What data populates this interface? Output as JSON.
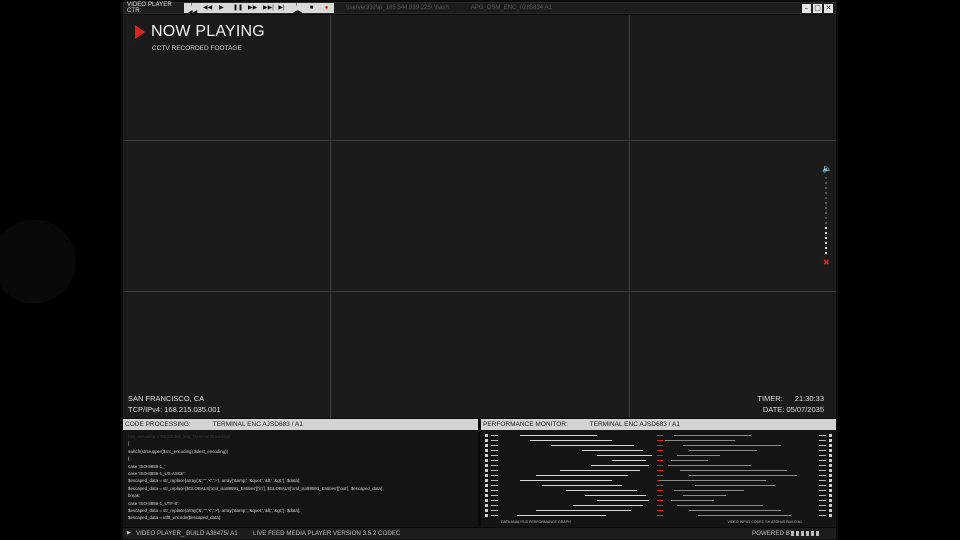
{
  "topbar": {
    "title": "VIDEO PLAYER CTR:",
    "controls": [
      {
        "name": "previous-chapter-icon",
        "glyph": "|◀◀"
      },
      {
        "name": "rewind-icon",
        "glyph": "◀◀"
      },
      {
        "name": "play-icon",
        "glyph": "▶"
      },
      {
        "name": "pause-icon",
        "glyph": "❚❚"
      },
      {
        "name": "fast-forward-icon",
        "glyph": "▶▶"
      },
      {
        "name": "next-chapter-icon",
        "glyph": "▶▶|"
      },
      {
        "name": "step-forward-icon",
        "glyph": "▶|"
      },
      {
        "name": "step-back-icon",
        "glyph": "|◀▶"
      },
      {
        "name": "stop-icon",
        "glyph": "■"
      },
      {
        "name": "record-icon",
        "glyph": "●"
      }
    ],
    "path": "\\\\server332\\ip_185.544.889.225\\ \\hash",
    "codec": "APG_OSM_ENC_0285834 A1",
    "window_buttons": [
      {
        "name": "minimize-icon",
        "glyph": "–"
      },
      {
        "name": "maximize-icon",
        "glyph": "▢"
      },
      {
        "name": "close-icon",
        "glyph": "✕"
      }
    ]
  },
  "video": {
    "now_playing": "NOW PLAYING",
    "subtitle": "CCTV RECORDED FOOTAGE",
    "location": "SAN FRANCISCO, CA",
    "tcp": "TCP/IPv4: 168.215.035.001",
    "timer_label": "TIMER:",
    "timer_value": "21:30:33",
    "date": "DATE: 05/07/2035",
    "volume_level": 0.4,
    "volume_steps": 16
  },
  "code_panel": {
    "title": "CODE PROCESSING:",
    "terminal": "TERMINAL ENC AJSD683 / A1",
    "lines": [
      {
        "text": "fast_encoding = RE(Global_seq_Terminal Encoding)",
        "faded": true
      },
      {
        "text": "{",
        "faded": false
      },
      {
        "text": "switch(strtoupper($src_encoding)   $dest_encoding))",
        "faded": false
      },
      {
        "text": "{",
        "faded": false
      },
      {
        "text": "case 'ISO-8859-1_':",
        "faded": false
      },
      {
        "text": "case 'ISO-8859-1_US-ASCII':",
        "faded": false
      },
      {
        "text": "$escaped_data = str_replace(array('&','\"','<','>'), array('&amp;','&quot;','&lt;','&gt;'), $data);",
        "faded": false
      },
      {
        "text": "$escaped_data = str_replace($GLOBALS['xml_iso88591_Entities']['in'], $GLOBALS['xml_iso88591_Entities']['out'], $escaped_data);",
        "faded": false
      },
      {
        "text": "break;",
        "faded": false
      },
      {
        "text": "case 'ISO-8859-1_UTF-8':",
        "faded": false
      },
      {
        "text": "$escaped_data = str_replace(array('&','\"','<','>'), array('&amp;','&quot;','&lt;','&gt;'), $data);",
        "faded": false
      },
      {
        "text": "$escaped_data = utf8_encode($escaped_data);",
        "faded": false
      }
    ]
  },
  "perf_panel": {
    "title": "PERFORMANCE MONITOR:",
    "terminal": "TERMINAL ENC AJSD683 / A1",
    "left_footer": "DATA ANALYSIS PERFORMANCE GRAPH",
    "right_footer": "VIDEO INPUT CODEC SH ATGH4S BUILD A1",
    "rows": [
      {
        "segments": [
          [
            0.05,
            0.3
          ],
          [
            0.55,
            0.8
          ]
        ]
      },
      {
        "segments": [
          [
            0.08,
            0.35
          ],
          [
            0.52,
            0.75
          ]
        ]
      },
      {
        "segments": [
          [
            0.15,
            0.42
          ],
          [
            0.58,
            0.9
          ]
        ]
      },
      {
        "segments": [
          [
            0.25,
            0.45
          ],
          [
            0.6,
            0.82
          ]
        ]
      },
      {
        "segments": [
          [
            0.3,
            0.48
          ],
          [
            0.56,
            0.7
          ]
        ]
      },
      {
        "segments": [
          [
            0.35,
            0.46
          ],
          [
            0.54,
            0.66
          ]
        ]
      },
      {
        "segments": [
          [
            0.28,
            0.47
          ],
          [
            0.53,
            0.8
          ]
        ]
      },
      {
        "segments": [
          [
            0.18,
            0.44
          ],
          [
            0.57,
            0.92
          ]
        ]
      },
      {
        "segments": [
          [
            0.1,
            0.4
          ],
          [
            0.6,
            0.95
          ]
        ]
      },
      {
        "segments": [
          [
            0.05,
            0.35
          ],
          [
            0.5,
            0.85
          ]
        ]
      },
      {
        "segments": [
          [
            0.12,
            0.38
          ],
          [
            0.62,
            0.88
          ]
        ]
      },
      {
        "segments": [
          [
            0.2,
            0.43
          ],
          [
            0.55,
            0.78
          ]
        ]
      },
      {
        "segments": [
          [
            0.26,
            0.46
          ],
          [
            0.58,
            0.72
          ]
        ]
      },
      {
        "segments": [
          [
            0.3,
            0.47
          ],
          [
            0.54,
            0.68
          ]
        ]
      },
      {
        "segments": [
          [
            0.22,
            0.45
          ],
          [
            0.56,
            0.84
          ]
        ]
      },
      {
        "segments": [
          [
            0.1,
            0.41
          ],
          [
            0.6,
            0.9
          ]
        ]
      },
      {
        "segments": [
          [
            0.04,
            0.33
          ],
          [
            0.63,
            0.93
          ]
        ]
      }
    ]
  },
  "status": {
    "build": "VIDEO PLAYER_ BUILD A38475/ A1",
    "live": "LIVE FEED MEDIA PLAYER VERSION 3.5.2 CODEC",
    "powered": "POWERED BY"
  },
  "colors": {
    "accent": "#e02020",
    "panel_header": "#d3d3d3",
    "video_bg": "#1b1b1b"
  }
}
